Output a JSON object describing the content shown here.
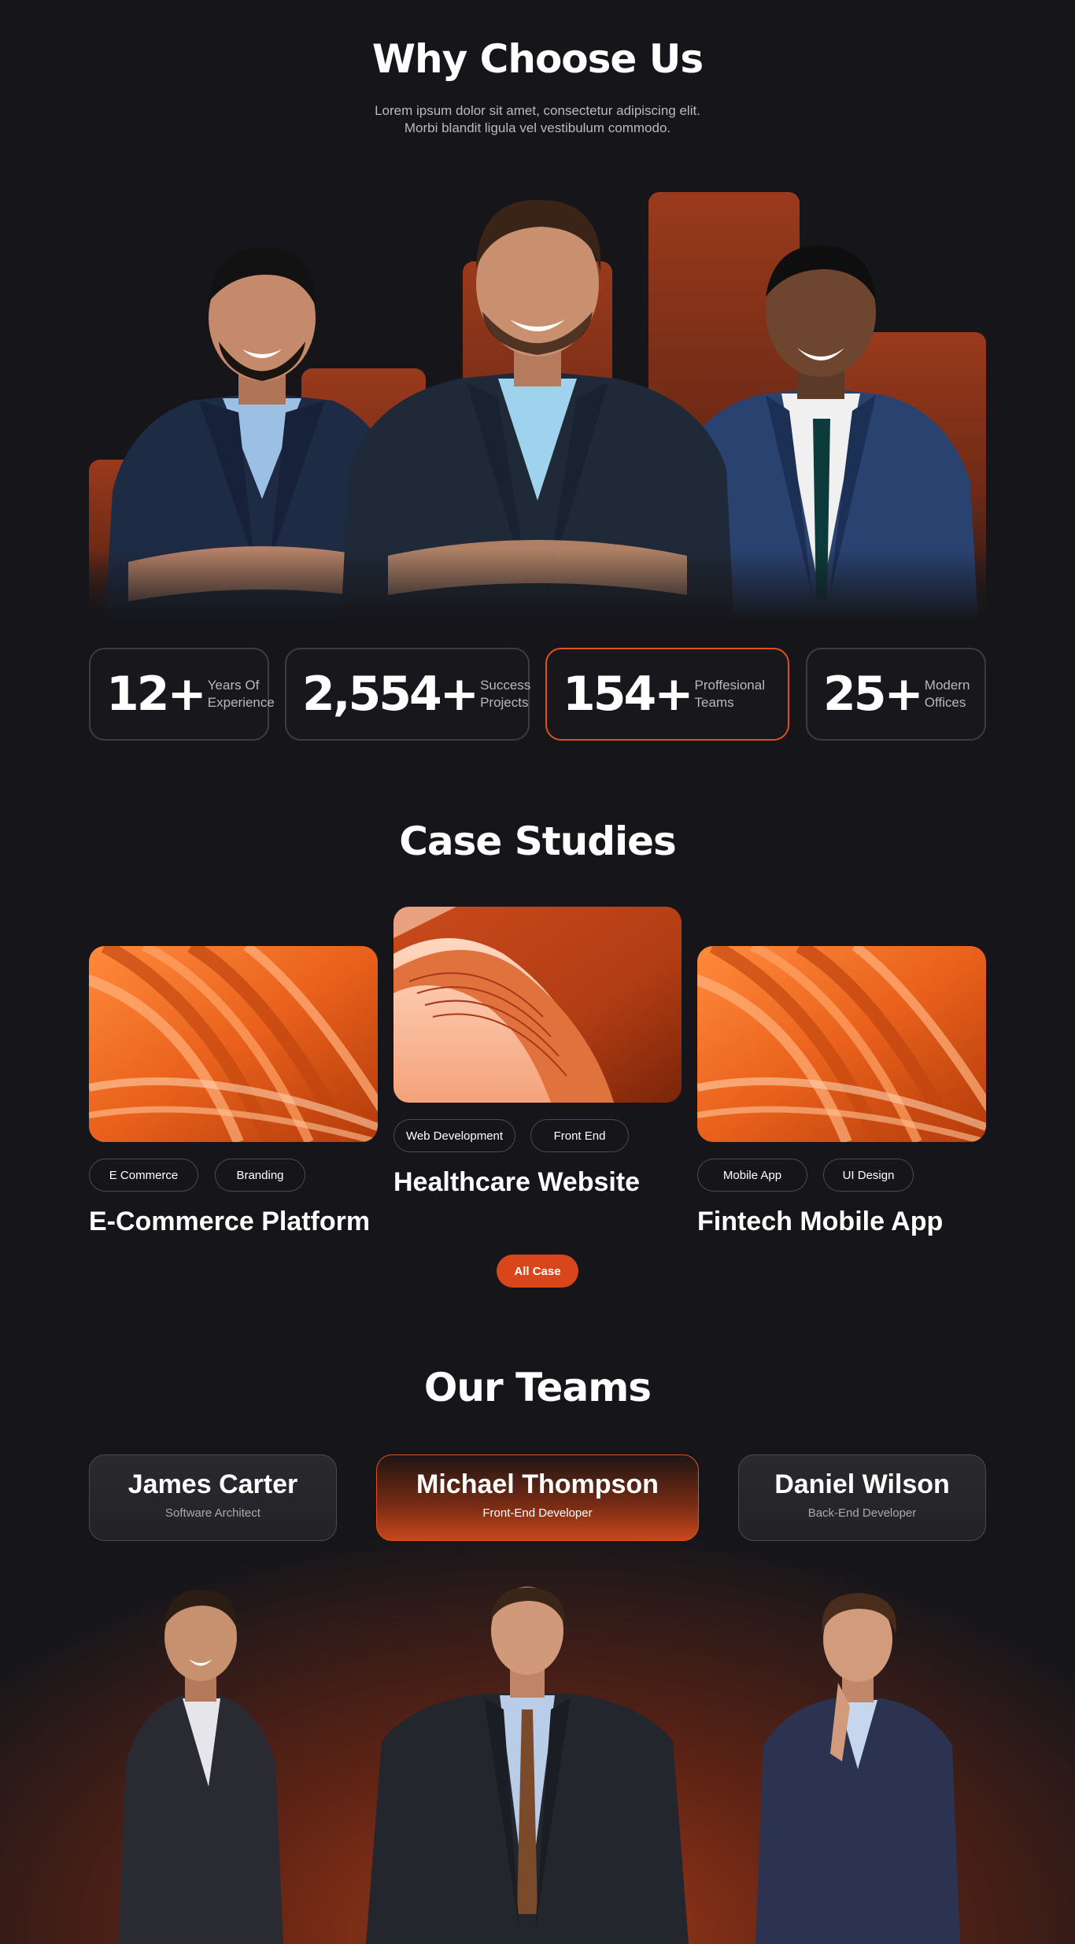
{
  "why": {
    "title": "Why Choose Us",
    "subtitle_line1": "Lorem ipsum dolor sit amet, consectetur adipiscing elit.",
    "subtitle_line2": "Morbi blandit ligula vel vestibulum commodo."
  },
  "stats": [
    {
      "number": "12+",
      "label": "Years Of\nExperience"
    },
    {
      "number": "2,554+",
      "label": "Success\nProjects"
    },
    {
      "number": "154+",
      "label": "Proffesional\nTeams"
    },
    {
      "number": "25+",
      "label": "Modern\nOffices"
    }
  ],
  "cases": {
    "title": "Case Studies",
    "items": [
      {
        "tags": [
          "E Commerce",
          "Branding"
        ],
        "title": "E-Commerce Platform"
      },
      {
        "tags": [
          "Web Development",
          "Front End"
        ],
        "title": "Healthcare Website"
      },
      {
        "tags": [
          "Mobile App",
          "UI Design"
        ],
        "title": "Fintech Mobile App"
      }
    ],
    "button": "All Case"
  },
  "teams": {
    "title": "Our Teams",
    "members": [
      {
        "name": "James Carter",
        "role": "Software Architect"
      },
      {
        "name": "Michael Thompson",
        "role": "Front-End Developer"
      },
      {
        "name": "Daniel Wilson",
        "role": "Back-End Developer"
      }
    ]
  },
  "colors": {
    "accent": "#d9461c",
    "background": "#16161a"
  }
}
